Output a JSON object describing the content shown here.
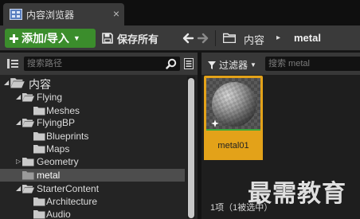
{
  "window": {
    "tab_title": "内容浏览器",
    "close_glyph": "×"
  },
  "toolbar": {
    "add_import_label": "添加/导入",
    "save_all_label": "保存所有",
    "breadcrumb": [
      "内容",
      "metal"
    ],
    "breadcrumb_sep": "▸",
    "accent_color": "#3b8d2c"
  },
  "sources": {
    "search_placeholder": "搜索路径",
    "tree": [
      {
        "label": "内容",
        "level": 0,
        "expanded": true,
        "root": true
      },
      {
        "label": "Flying",
        "level": 1,
        "expanded": true
      },
      {
        "label": "Meshes",
        "level": 2
      },
      {
        "label": "FlyingBP",
        "level": 1,
        "expanded": true
      },
      {
        "label": "Blueprints",
        "level": 2
      },
      {
        "label": "Maps",
        "level": 2
      },
      {
        "label": "Geometry",
        "level": 1,
        "expanded": false
      },
      {
        "label": "metal",
        "level": 1,
        "selected": true
      },
      {
        "label": "StarterContent",
        "level": 1,
        "expanded": true
      },
      {
        "label": "Architecture",
        "level": 2
      },
      {
        "label": "Audio",
        "level": 2
      }
    ]
  },
  "assets": {
    "filter_label": "过滤器",
    "search_placeholder": "搜索 metal",
    "items": [
      {
        "name": "metal01",
        "type_icon": "material-sphere-icon",
        "highlight_color": "#e3a219"
      }
    ],
    "status_text": "1项（1被选中）"
  },
  "watermark": "最需教育"
}
